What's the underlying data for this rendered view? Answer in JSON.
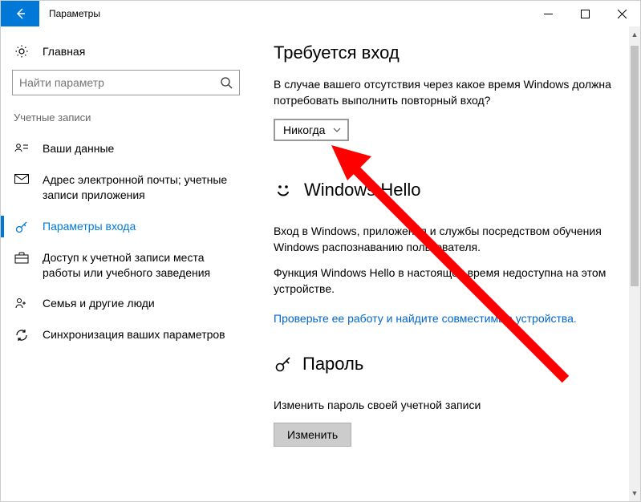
{
  "titlebar": {
    "title": "Параметры"
  },
  "sidebar": {
    "home": "Главная",
    "search_placeholder": "Найти параметр",
    "category": "Учетные записи",
    "items": [
      {
        "label": "Ваши данные"
      },
      {
        "label": "Адрес электронной почты; учетные записи приложения"
      },
      {
        "label": "Параметры входа"
      },
      {
        "label": "Доступ к учетной записи места работы или учебного заведения"
      },
      {
        "label": "Семья и другие люди"
      },
      {
        "label": "Синхронизация ваших параметров"
      }
    ]
  },
  "main": {
    "signin_heading": "Требуется вход",
    "signin_text": "В случае вашего отсутствия через какое время Windows должна потребовать выполнить повторный вход?",
    "dropdown_value": "Никогда",
    "hello_heading": "Windows Hello",
    "hello_text1": "Вход в Windows, приложения и службы посредством обучения Windows распознаванию пользователя.",
    "hello_text2": "Функция Windows Hello в настоящее время недоступна на этом устройстве.",
    "hello_link": "Проверьте ее работу и найдите совместимые устройства.",
    "password_heading": "Пароль",
    "password_text": "Изменить пароль своей учетной записи",
    "password_button": "Изменить"
  }
}
